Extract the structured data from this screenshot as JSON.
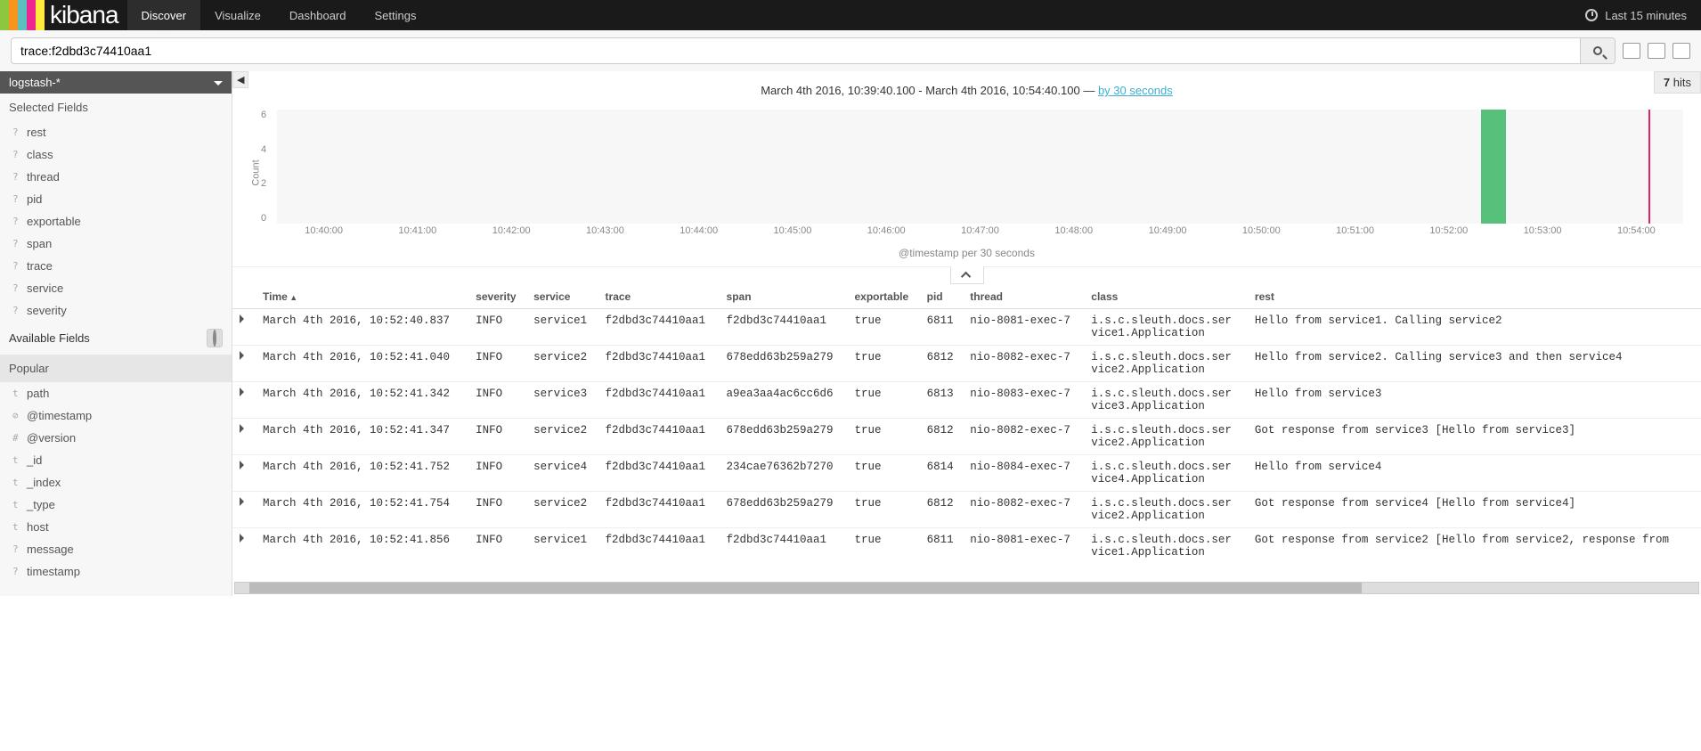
{
  "brand": "kibana",
  "nav": {
    "tabs": [
      "Discover",
      "Visualize",
      "Dashboard",
      "Settings"
    ],
    "active": 0,
    "timepicker": "Last 15 minutes"
  },
  "search": {
    "query": "trace:f2dbd3c74410aa1"
  },
  "hits": {
    "count": "7",
    "label": "hits"
  },
  "index_pattern": "logstash-*",
  "sidebar": {
    "selected_title": "Selected Fields",
    "selected": [
      "rest",
      "class",
      "thread",
      "pid",
      "exportable",
      "span",
      "trace",
      "service",
      "severity"
    ],
    "available_title": "Available Fields",
    "popular_title": "Popular",
    "available": [
      {
        "t": "t",
        "n": "path"
      },
      {
        "t": "⊘",
        "n": "@timestamp"
      },
      {
        "t": "#",
        "n": "@version"
      },
      {
        "t": "t",
        "n": "_id"
      },
      {
        "t": "t",
        "n": "_index"
      },
      {
        "t": "t",
        "n": "_type"
      },
      {
        "t": "t",
        "n": "host"
      },
      {
        "t": "?",
        "n": "message"
      },
      {
        "t": "?",
        "n": "timestamp"
      }
    ]
  },
  "timerange": {
    "from": "March 4th 2016, 10:39:40.100",
    "to": "March 4th 2016, 10:54:40.100",
    "interval": "by 30 seconds"
  },
  "chart_data": {
    "type": "bar",
    "ylabel": "Count",
    "xlabel": "@timestamp per 30 seconds",
    "ylim": [
      0,
      7
    ],
    "y_ticks": [
      0,
      2,
      4,
      6
    ],
    "x_ticks": [
      "10:40:00",
      "10:41:00",
      "10:42:00",
      "10:43:00",
      "10:44:00",
      "10:45:00",
      "10:46:00",
      "10:47:00",
      "10:48:00",
      "10:49:00",
      "10:50:00",
      "10:51:00",
      "10:52:00",
      "10:53:00",
      "10:54:00"
    ],
    "bars": [
      {
        "x_pct": 85.6,
        "value": 7,
        "w_pct": 1.8
      }
    ]
  },
  "columns": [
    "Time",
    "severity",
    "service",
    "trace",
    "span",
    "exportable",
    "pid",
    "thread",
    "class",
    "rest"
  ],
  "rows": [
    {
      "time": "March 4th 2016, 10:52:40.837",
      "severity": "INFO",
      "service": "service1",
      "trace": "f2dbd3c74410aa1",
      "span": "f2dbd3c74410aa1",
      "exportable": "true",
      "pid": "6811",
      "thread": "nio-8081-exec-7",
      "class": "i.s.c.sleuth.docs.ser\nvice1.Application",
      "rest": "Hello from service1. Calling service2"
    },
    {
      "time": "March 4th 2016, 10:52:41.040",
      "severity": "INFO",
      "service": "service2",
      "trace": "f2dbd3c74410aa1",
      "span": "678edd63b259a279",
      "exportable": "true",
      "pid": "6812",
      "thread": "nio-8082-exec-7",
      "class": "i.s.c.sleuth.docs.ser\nvice2.Application",
      "rest": "Hello from service2. Calling service3 and then service4"
    },
    {
      "time": "March 4th 2016, 10:52:41.342",
      "severity": "INFO",
      "service": "service3",
      "trace": "f2dbd3c74410aa1",
      "span": "a9ea3aa4ac6cc6d6",
      "exportable": "true",
      "pid": "6813",
      "thread": "nio-8083-exec-7",
      "class": "i.s.c.sleuth.docs.ser\nvice3.Application",
      "rest": "Hello from service3"
    },
    {
      "time": "March 4th 2016, 10:52:41.347",
      "severity": "INFO",
      "service": "service2",
      "trace": "f2dbd3c74410aa1",
      "span": "678edd63b259a279",
      "exportable": "true",
      "pid": "6812",
      "thread": "nio-8082-exec-7",
      "class": "i.s.c.sleuth.docs.ser\nvice2.Application",
      "rest": "Got response from service3 [Hello from service3]"
    },
    {
      "time": "March 4th 2016, 10:52:41.752",
      "severity": "INFO",
      "service": "service4",
      "trace": "f2dbd3c74410aa1",
      "span": "234cae76362b7270",
      "exportable": "true",
      "pid": "6814",
      "thread": "nio-8084-exec-7",
      "class": "i.s.c.sleuth.docs.ser\nvice4.Application",
      "rest": "Hello from service4"
    },
    {
      "time": "March 4th 2016, 10:52:41.754",
      "severity": "INFO",
      "service": "service2",
      "trace": "f2dbd3c74410aa1",
      "span": "678edd63b259a279",
      "exportable": "true",
      "pid": "6812",
      "thread": "nio-8082-exec-7",
      "class": "i.s.c.sleuth.docs.ser\nvice2.Application",
      "rest": "Got response from service4 [Hello from service4]"
    },
    {
      "time": "March 4th 2016, 10:52:41.856",
      "severity": "INFO",
      "service": "service1",
      "trace": "f2dbd3c74410aa1",
      "span": "f2dbd3c74410aa1",
      "exportable": "true",
      "pid": "6811",
      "thread": "nio-8081-exec-7",
      "class": "i.s.c.sleuth.docs.ser\nvice1.Application",
      "rest": "Got response from service2 [Hello from service2, response from"
    }
  ]
}
